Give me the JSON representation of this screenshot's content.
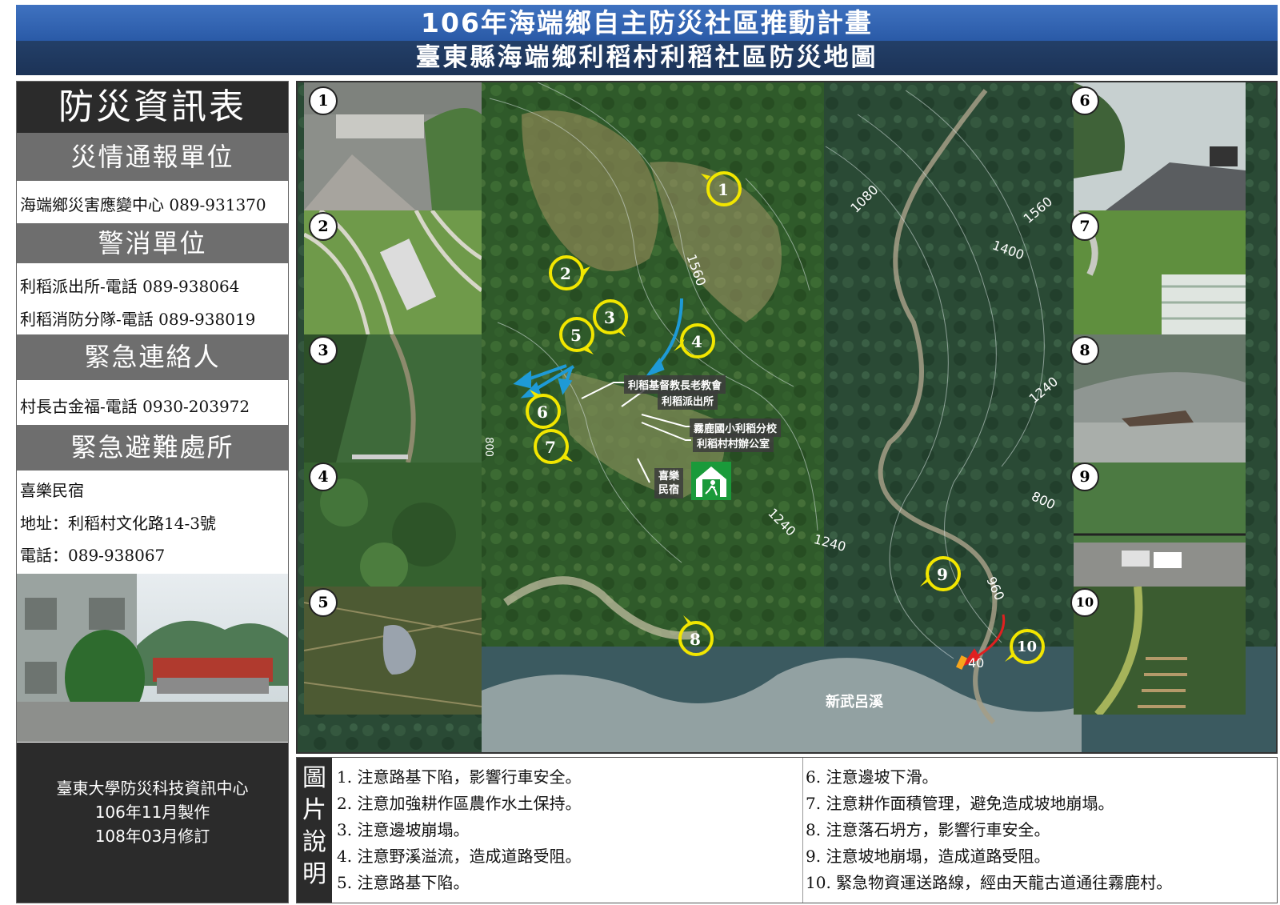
{
  "header": {
    "title": "106年海端鄉自主防災社區推動計畫",
    "subtitle": "臺東縣海端鄉利稻村利稻社區防災地圖"
  },
  "info_panel": {
    "title": "防災資訊表",
    "disaster_report": {
      "heading": "災情通報單位",
      "lines": [
        "海端鄉災害應變中心 089-931370"
      ]
    },
    "police_fire": {
      "heading": "警消單位",
      "lines": [
        "利稻派出所-電話  089-938064",
        "利稻消防分隊-電話  089-938019"
      ]
    },
    "emergency_contact": {
      "heading": "緊急連絡人",
      "lines": [
        "村長古金福-電話  0930-203972"
      ]
    },
    "shelter": {
      "heading": "緊急避難處所",
      "lines": [
        "喜樂民宿",
        "地址：利稻村文化路14-3號",
        "電話：089-938067"
      ]
    },
    "footer": [
      "臺東大學防災科技資訊中心",
      "106年11月製作",
      "108年03月修訂"
    ]
  },
  "map": {
    "places": [
      "利稻基督教長老教會",
      "利稻派出所",
      "霧鹿國小利稻分校",
      "利稻村村辦公室",
      "喜樂\n民宿"
    ],
    "river": "新武呂溪",
    "contours": [
      "1080",
      "1560",
      "1560",
      "1400",
      "1240",
      "800",
      "1240",
      "1240",
      "960",
      "40",
      "800"
    ],
    "markers": [
      "1",
      "2",
      "3",
      "4",
      "5",
      "6",
      "7",
      "8",
      "9",
      "10"
    ],
    "photo_badges_left": [
      "1",
      "2",
      "3",
      "4",
      "5"
    ],
    "photo_badges_right": [
      "6",
      "7",
      "8",
      "9",
      "10"
    ],
    "colors": {
      "marker": "#f2e600",
      "flow_arrow": "#1e9ad6",
      "route_arrow": "#e02020",
      "shelter_icon": "#1a9a3a"
    }
  },
  "legend": {
    "label": [
      "圖",
      "片",
      "說",
      "明"
    ],
    "items_left": [
      "1. 注意路基下陷，影響行車安全。",
      "2. 注意加強耕作區農作水土保持。",
      "3. 注意邊坡崩塌。",
      "4. 注意野溪溢流，造成道路受阻。",
      "5. 注意路基下陷。"
    ],
    "items_right": [
      "6. 注意邊坡下滑。",
      "7. 注意耕作面積管理，避免造成坡地崩塌。",
      "8. 注意落石坍方，影響行車安全。",
      "9. 注意坡地崩塌，造成道路受阻。",
      "10. 緊急物資運送路線，經由天龍古道通往霧鹿村。"
    ]
  }
}
